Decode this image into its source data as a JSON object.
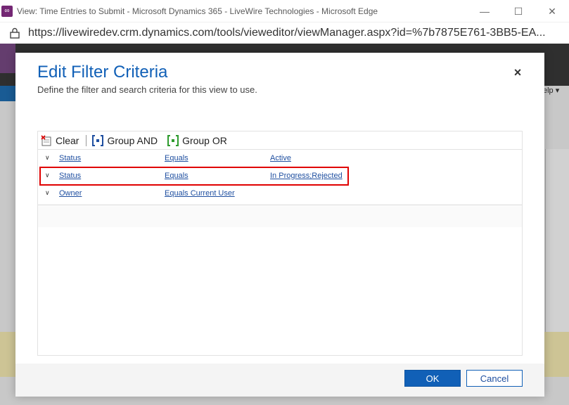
{
  "window": {
    "title": "View: Time Entries to Submit - Microsoft Dynamics 365 - LiveWire Technologies - Microsoft Edge",
    "url": "https://livewiredev.crm.dynamics.com/tools/vieweditor/viewManager.aspx?id=%7b7875E761-3BB5-EA..."
  },
  "background": {
    "help_text": "elp ▾"
  },
  "dialog": {
    "title": "Edit Filter Criteria",
    "subtitle": "Define the filter and search criteria for this view to use.",
    "toolbar": {
      "clear_label": "Clear",
      "group_and_label": "Group AND",
      "group_or_label": "Group OR"
    },
    "rows": [
      {
        "field": "Status",
        "operator": "Equals",
        "value": "Active"
      },
      {
        "field": "Status",
        "operator": "Equals",
        "value": "In Progress;Rejected"
      },
      {
        "field": "Owner",
        "operator": "Equals Current User",
        "value": ""
      }
    ],
    "ok_label": "OK",
    "cancel_label": "Cancel"
  },
  "colors": {
    "accent": "#1160b7",
    "highlight": "#e00000"
  }
}
